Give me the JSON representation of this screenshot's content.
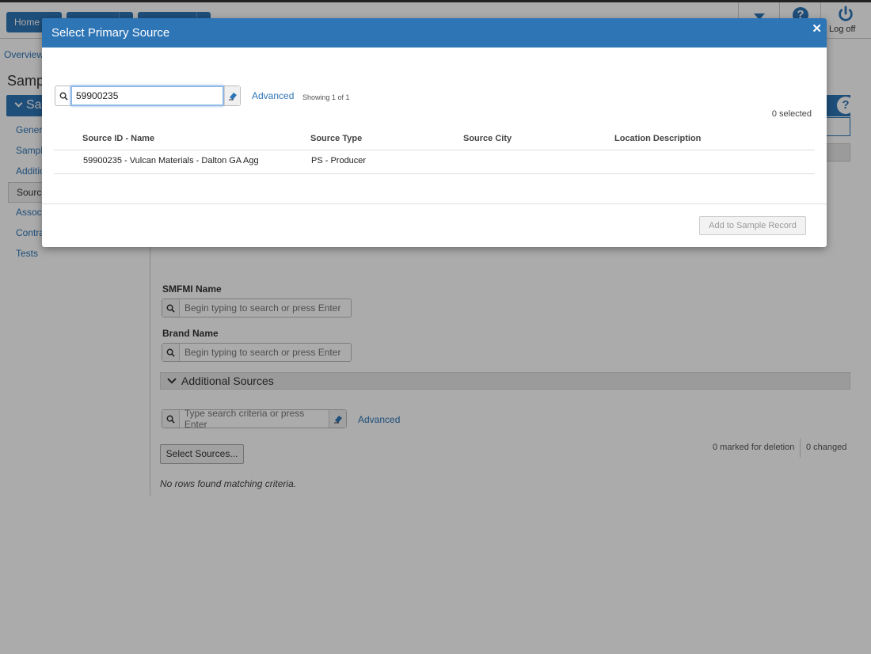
{
  "app": {
    "nav": {
      "home": "Home"
    },
    "logoff": "Log off",
    "breadcrumb": "Overview",
    "page_title": "Samp",
    "sidebar": {
      "header": "Sa",
      "items": [
        "Genera",
        "Sample",
        "Additio",
        "Source",
        "Associ",
        "Contra",
        "Tests"
      ]
    },
    "form": {
      "smfmi_label": "SMFMI Name",
      "smfmi_placeholder": "Begin typing to search or press Enter",
      "brand_label": "Brand Name",
      "brand_placeholder": "Begin typing to search or press Enter",
      "additional_sources": "Additional Sources",
      "add_search_placeholder": "Type search criteria or press Enter",
      "advanced": "Advanced",
      "select_sources": "Select Sources...",
      "marked_for_deletion": "0 marked for deletion",
      "changed": "0 changed",
      "no_rows": "No rows found matching criteria."
    }
  },
  "modal": {
    "title": "Select Primary Source",
    "search_value": "59900235",
    "advanced": "Advanced",
    "showing": "Showing 1 of 1",
    "selected": "0 selected",
    "columns": [
      "Source ID - Name",
      "Source Type",
      "Source City",
      "Location Description"
    ],
    "rows": [
      {
        "id_name": "59900235 - Vulcan Materials - Dalton GA Agg",
        "type": "PS - Producer",
        "city": "",
        "location": ""
      }
    ],
    "add_button": "Add to Sample Record"
  },
  "icons": [
    "search-icon",
    "eraser-icon",
    "close-icon",
    "chevron-down-icon",
    "help-icon",
    "power-icon"
  ],
  "colors": {
    "primary": "#2e75b6",
    "overlay": "rgba(0,0,0,0.33)"
  }
}
